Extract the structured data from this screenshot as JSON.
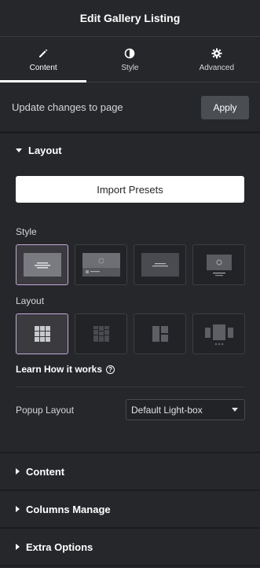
{
  "header": {
    "title": "Edit Gallery Listing"
  },
  "tabs": [
    {
      "label": "Content",
      "icon": "pencil-icon",
      "active": true
    },
    {
      "label": "Style",
      "icon": "contrast-icon",
      "active": false
    },
    {
      "label": "Advanced",
      "icon": "gear-icon",
      "active": false
    }
  ],
  "update": {
    "text": "Update changes to page",
    "apply_label": "Apply"
  },
  "layout_section": {
    "title": "Layout",
    "import_label": "Import Presets",
    "style_label": "Style",
    "layout_label": "Layout",
    "learn_label": "Learn How it works",
    "popup_label": "Popup Layout",
    "popup_value": "Default Light-box"
  },
  "sections": [
    {
      "title": "Content"
    },
    {
      "title": "Columns Manage"
    },
    {
      "title": "Extra Options"
    }
  ],
  "colors": {
    "background": "#26272b",
    "accent": "#c6a8d9",
    "button": "#4a4d52"
  }
}
